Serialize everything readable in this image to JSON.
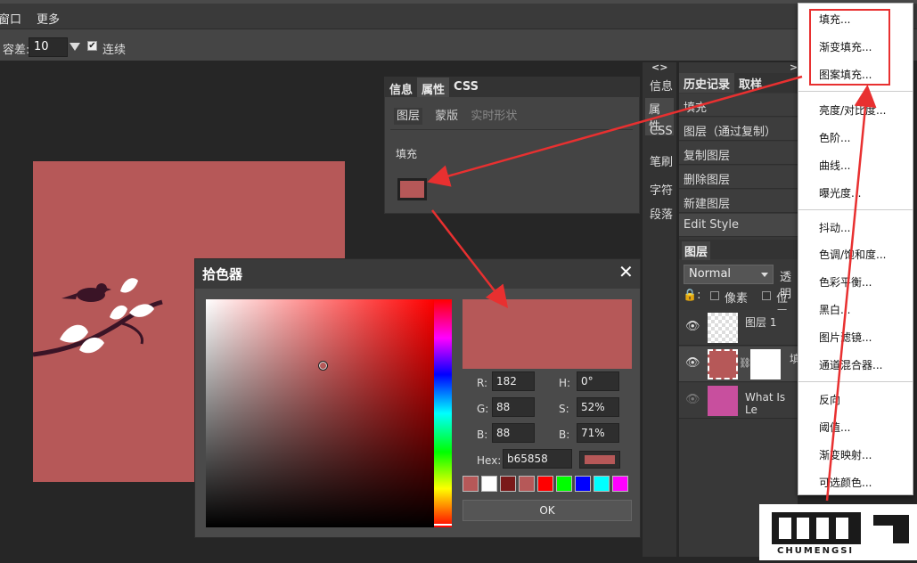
{
  "menubar": {
    "items": [
      "窗口",
      "更多"
    ]
  },
  "options": {
    "tolerance_label": "容差:",
    "tolerance_value": "10",
    "contiguous_label": "连续",
    "contiguous_checked": "✔"
  },
  "info_panel": {
    "tabs": [
      "信息",
      "属性",
      "CSS"
    ],
    "subtabs": [
      "图层",
      "蒙版",
      "实时形状"
    ],
    "fill_label": "填充",
    "fill_color": "#b65858"
  },
  "side_tabs": {
    "toggle": "<>",
    "items": [
      "信息",
      "属性",
      "CSS",
      "笔刷",
      "字符",
      "段落"
    ]
  },
  "history": {
    "toggle": ">",
    "tabs": [
      "历史记录",
      "取样"
    ],
    "items": [
      "填充",
      "图层（通过复制）",
      "复制图层",
      "删除图层",
      "新建图层",
      "Edit Style"
    ]
  },
  "layers": {
    "tab": "图层",
    "blend_mode": "Normal",
    "opacity_label": "透明",
    "lock_label": "🔒:",
    "lock_pixels": "像素",
    "lock_position": "位置",
    "rows": [
      {
        "name": "图层 1"
      },
      {
        "name": "填"
      },
      {
        "name": "What Is Le"
      }
    ]
  },
  "context_menu": {
    "group1": [
      "填充...",
      "渐变填充...",
      "图案填充..."
    ],
    "group2": [
      "亮度/对比度...",
      "色阶...",
      "曲线...",
      "曝光度..."
    ],
    "group3": [
      "抖动...",
      "色调/饱和度...",
      "色彩平衡...",
      "黑白...",
      "图片滤镜...",
      "通道混合器..."
    ],
    "group4": [
      "反向",
      "阈值...",
      "渐变映射...",
      "可选颜色..."
    ]
  },
  "color_picker": {
    "title": "拾色器",
    "close": "✕",
    "r_label": "R:",
    "r": "182",
    "g_label": "G:",
    "g": "88",
    "b_label": "B:",
    "b": "88",
    "h_label": "H:",
    "h": "0°",
    "s_label": "S:",
    "s": "52%",
    "v_label": "B:",
    "v": "71%",
    "hex_label": "Hex:",
    "hex": "b65858",
    "ok": "OK",
    "current_color": "#b65858",
    "swatches": [
      "#b65858",
      "#ffffff",
      "#7a1a1a",
      "#b65858",
      "#ff0000",
      "#00ff00",
      "#0000ff",
      "#00ffff",
      "#ff00ff"
    ]
  },
  "watermark": {
    "brand": "CHUMENGSI"
  }
}
